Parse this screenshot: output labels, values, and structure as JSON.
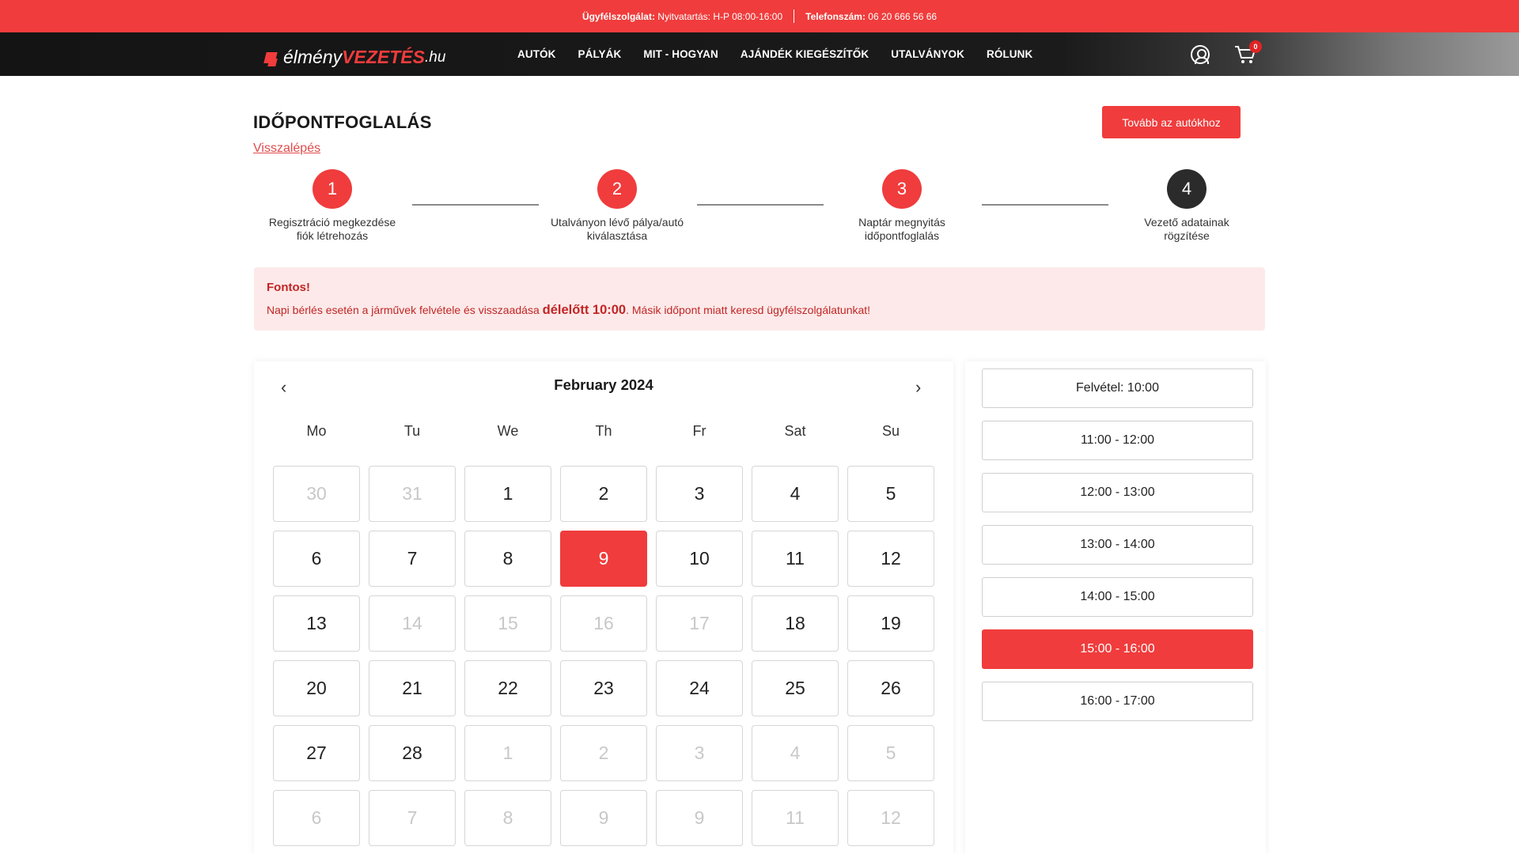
{
  "topbar": {
    "service_label": "Ügyfélszolgálat:",
    "service_value": "Nyitvatartás: H-P 08:00-16:00",
    "phone_label": "Telefonszám:",
    "phone_value": "06 20 666 56 66"
  },
  "nav": {
    "logo": {
      "part1": "élmény",
      "part2": "VEZETÉS",
      "part3": ".hu"
    },
    "items": [
      "AUTÓK",
      "PÁLYÁK",
      "MIT - HOGYAN",
      "AJÁNDÉK KIEGÉSZÍTŐK",
      "UTALVÁNYOK",
      "RÓLUNK"
    ],
    "cart_count": "0"
  },
  "page": {
    "title": "IDŐPONTFOGLALÁS",
    "back": "Visszalépés",
    "next_button": "Tovább az autókhoz"
  },
  "steps": [
    {
      "num": "1",
      "line1": "Regisztráció megkezdése",
      "line2": "fiók létrehozás"
    },
    {
      "num": "2",
      "line1": "Utalványon lévő pálya/autó",
      "line2": "kiválasztása"
    },
    {
      "num": "3",
      "line1": "Naptár megnyitás",
      "line2": "időpontfoglalás"
    },
    {
      "num": "4",
      "line1": "Vezető adatainak",
      "line2": "rögzítése"
    }
  ],
  "alert": {
    "title": "Fontos!",
    "text_before": "Napi bérlés esetén a járművek felvétele és visszaadása ",
    "text_bold": "délelőtt 10:00",
    "text_after": ". Másik időpont miatt keresd ügyfélszolgálatunkat!"
  },
  "calendar": {
    "prev": "‹",
    "next": "›",
    "month": "February 2024",
    "weekdays": [
      "Mo",
      "Tu",
      "We",
      "Th",
      "Fr",
      "Sat",
      "Su"
    ],
    "weeks": [
      [
        "30",
        "31",
        "1",
        "2",
        "3",
        "4",
        "5"
      ],
      [
        "6",
        "7",
        "8",
        "9",
        "10",
        "11",
        "12"
      ],
      [
        "13",
        "14",
        "15",
        "16",
        "17",
        "18",
        "19"
      ],
      [
        "20",
        "21",
        "22",
        "23",
        "24",
        "25",
        "26"
      ],
      [
        "27",
        "28",
        "1",
        "2",
        "3",
        "4",
        "5"
      ],
      [
        "6",
        "7",
        "8",
        "9",
        "9",
        "11",
        "12"
      ]
    ],
    "disabled": [
      [
        true,
        true,
        false,
        false,
        false,
        false,
        false
      ],
      [
        false,
        false,
        false,
        false,
        false,
        false,
        false
      ],
      [
        false,
        true,
        true,
        true,
        true,
        false,
        false
      ],
      [
        false,
        false,
        false,
        false,
        false,
        false,
        false
      ],
      [
        false,
        false,
        true,
        true,
        true,
        true,
        true
      ],
      [
        true,
        true,
        true,
        true,
        true,
        true,
        true
      ]
    ],
    "selected": "9"
  },
  "slots": {
    "items": [
      "Felvétel: 10:00",
      "11:00 - 12:00",
      "12:00 - 13:00",
      "13:00 - 14:00",
      "14:00 - 15:00",
      "15:00 - 16:00",
      "16:00 - 17:00"
    ],
    "selected": "15:00 - 16:00"
  },
  "colors": {
    "accent": "#f03c3c",
    "dark": "#141414",
    "alert_bg": "#fde9e9"
  }
}
